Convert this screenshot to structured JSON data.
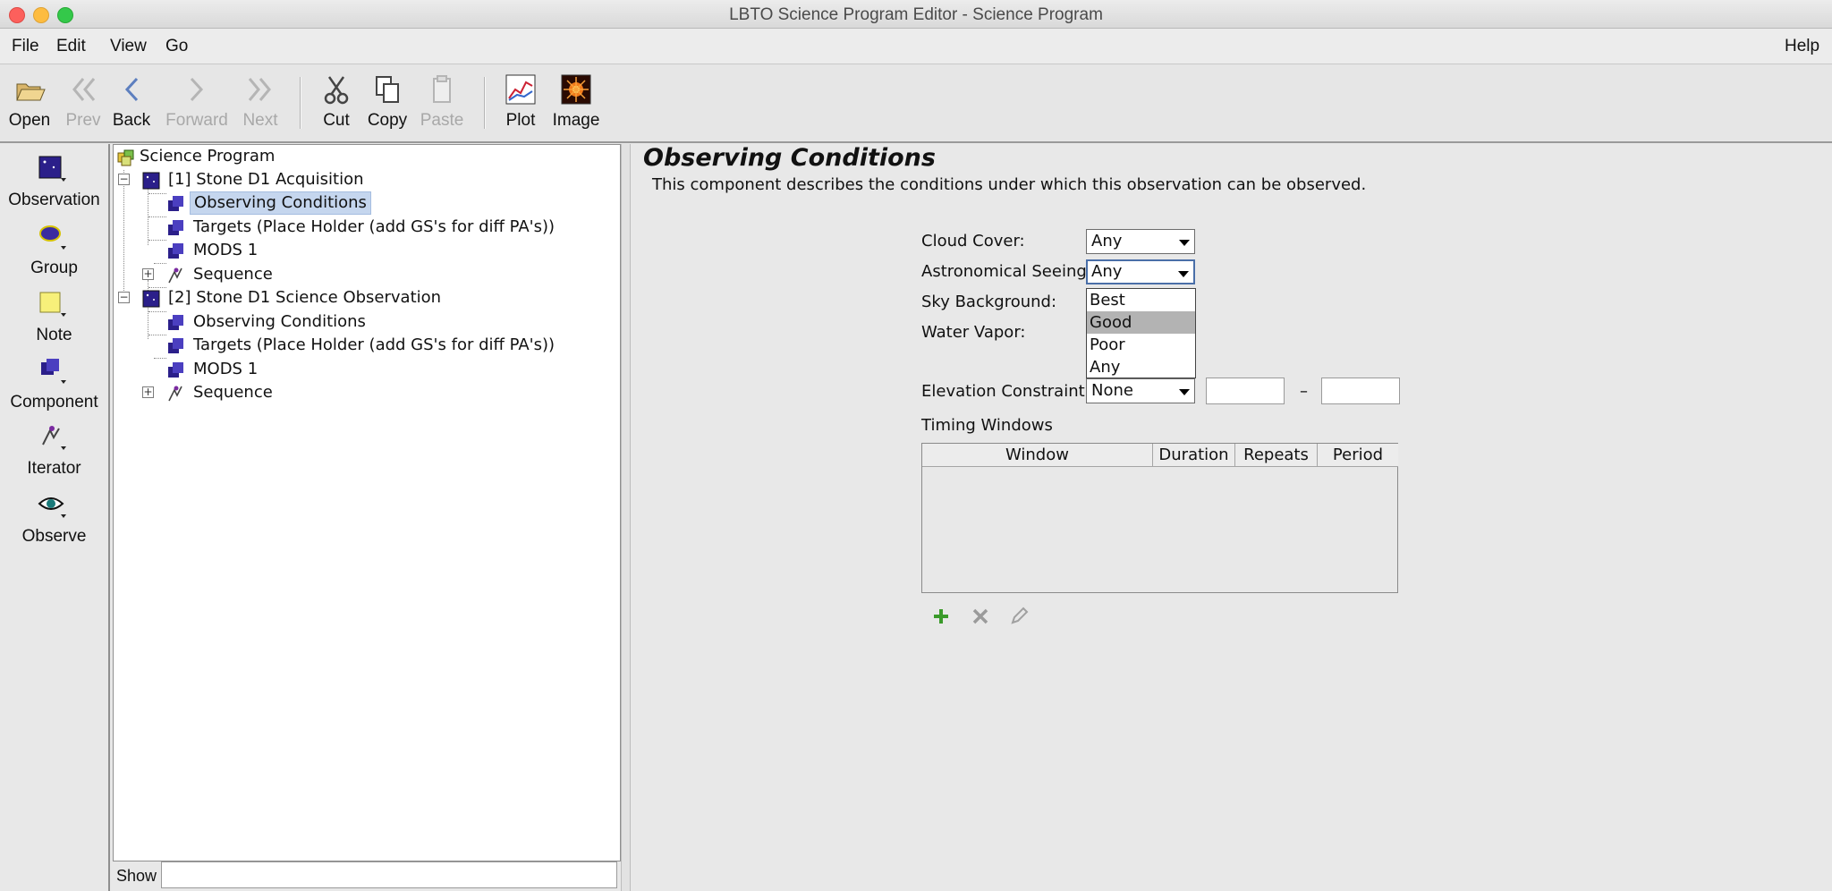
{
  "window": {
    "title": "LBTO Science Program Editor - Science Program"
  },
  "menu": {
    "file": "File",
    "edit": "Edit",
    "view": "View",
    "go": "Go",
    "help": "Help"
  },
  "toolbar": {
    "open": "Open",
    "prev": "Prev",
    "back": "Back",
    "forward": "Forward",
    "next": "Next",
    "cut": "Cut",
    "copy": "Copy",
    "paste": "Paste",
    "plot": "Plot",
    "image": "Image"
  },
  "palette": {
    "observation": "Observation",
    "group": "Group",
    "note": "Note",
    "component": "Component",
    "iterator": "Iterator",
    "observe": "Observe"
  },
  "tree": {
    "root": "Science Program",
    "obs1": {
      "label": "[1] Stone D1 Acquisition",
      "children": [
        "Observing Conditions",
        "Targets (Place Holder (add GS's for diff PA's))",
        "MODS 1",
        "Sequence"
      ]
    },
    "obs2": {
      "label": "[2] Stone D1 Science Observation",
      "children": [
        "Observing Conditions",
        "Targets (Place Holder (add GS's for diff PA's))",
        "MODS 1",
        "Sequence"
      ]
    },
    "selected": "Observing Conditions"
  },
  "show": {
    "label": "Show",
    "value": ""
  },
  "editor": {
    "title": "Observing Conditions",
    "description": "This component describes the conditions under which this observation can be observed.",
    "cloud_cover": {
      "label": "Cloud Cover:",
      "value": "Any"
    },
    "seeing": {
      "label": "Astronomical Seeing:",
      "value": "Any",
      "options": [
        "Best",
        "Good",
        "Poor",
        "Any"
      ],
      "highlighted": "Good"
    },
    "sky_background": {
      "label": "Sky Background:"
    },
    "water_vapor": {
      "label": "Water Vapor:"
    },
    "elevation": {
      "label": "Elevation Constraint:",
      "value": "None",
      "min": "",
      "max": "",
      "dash": "–"
    },
    "timing": {
      "label": "Timing Windows",
      "columns": [
        "Window",
        "Duration",
        "Repeats",
        "Period"
      ],
      "rows": []
    }
  },
  "colors": {
    "selection": "#c5d6ee",
    "dropdown_highlight": "#b3b3b3",
    "add": "#3a9a2a"
  }
}
